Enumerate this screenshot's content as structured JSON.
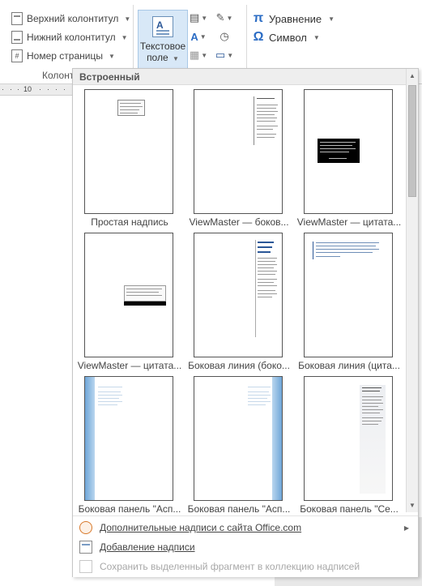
{
  "ribbon": {
    "header_footer": {
      "header_label": "Верхний колонтитул",
      "footer_label": "Нижний колонтитул",
      "page_number_label": "Номер страницы",
      "group_label": "Колонт"
    },
    "text_box": {
      "label_line1": "Текстовое",
      "label_line2": "поле"
    },
    "symbols": {
      "equation_label": "Уравнение",
      "symbol_label": "Символ"
    }
  },
  "ruler": {
    "tick_10": "10"
  },
  "gallery": {
    "section_title": "Встроенный",
    "items": [
      {
        "caption": "Простая надпись"
      },
      {
        "caption": "ViewMaster — боков..."
      },
      {
        "caption": "ViewMaster — цитата..."
      },
      {
        "caption": "ViewMaster — цитата..."
      },
      {
        "caption": "Боковая линия (боко..."
      },
      {
        "caption": "Боковая линия (цита..."
      },
      {
        "caption": "Боковая панель \"Асп..."
      },
      {
        "caption": "Боковая панель \"Асп..."
      },
      {
        "caption": "Боковая панель \"Се..."
      }
    ],
    "footer": {
      "more_from_office": "Дополнительные надписи с сайта Office.com",
      "draw_text_box": "Добавление надписи",
      "save_selection": "Сохранить выделенный фрагмент в коллекцию надписей"
    }
  },
  "colors": {
    "selected_button_bg": "#d8e8f7",
    "accent_blue": "#2b6cc4",
    "black_quote_block": "#000000",
    "aspect_blue_bar": "#9cc3e6"
  },
  "icons": [
    "header-icon",
    "footer-icon",
    "page-number-icon",
    "textbox-icon",
    "quick-parts-icon",
    "wordart-icon",
    "dropcap-icon",
    "signature-line-icon",
    "datetime-icon",
    "object-icon",
    "equation-icon",
    "symbol-icon",
    "office-icon",
    "draw-textbox-icon",
    "save-selection-icon"
  ]
}
